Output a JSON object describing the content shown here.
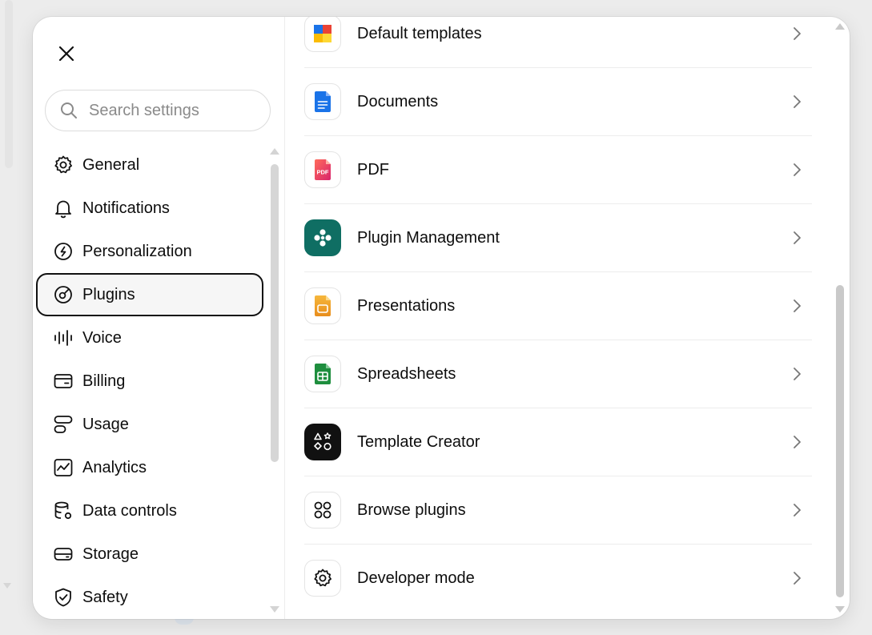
{
  "search": {
    "placeholder": "Search settings"
  },
  "sidebar": {
    "items": [
      {
        "label": "General",
        "icon": "gear-icon"
      },
      {
        "label": "Notifications",
        "icon": "bell-icon"
      },
      {
        "label": "Personalization",
        "icon": "personalization-icon"
      },
      {
        "label": "Plugins",
        "icon": "plugin-icon",
        "active": true
      },
      {
        "label": "Voice",
        "icon": "voice-waveform-icon"
      },
      {
        "label": "Billing",
        "icon": "card-icon"
      },
      {
        "label": "Usage",
        "icon": "usage-icon"
      },
      {
        "label": "Analytics",
        "icon": "analytics-chart-icon"
      },
      {
        "label": "Data controls",
        "icon": "database-gear-icon"
      },
      {
        "label": "Storage",
        "icon": "storage-drive-icon"
      },
      {
        "label": "Safety",
        "icon": "shield-check-icon"
      }
    ]
  },
  "plugins": {
    "items": [
      {
        "label": "Default templates",
        "icon": "default-templates-icon"
      },
      {
        "label": "Documents",
        "icon": "documents-icon"
      },
      {
        "label": "PDF",
        "icon": "pdf-icon",
        "icon_text": "PDF"
      },
      {
        "label": "Plugin Management",
        "icon": "plugin-management-icon"
      },
      {
        "label": "Presentations",
        "icon": "presentations-icon"
      },
      {
        "label": "Spreadsheets",
        "icon": "spreadsheets-icon"
      },
      {
        "label": "Template Creator",
        "icon": "template-creator-icon"
      },
      {
        "label": "Browse plugins",
        "icon": "browse-grid-icon"
      },
      {
        "label": "Developer mode",
        "icon": "developer-gear-icon"
      }
    ]
  },
  "colors": {
    "active_border": "#111111",
    "plugin_management_bg": "#0f6e63",
    "template_creator_bg": "#111111",
    "documents_blue": "#1a73e8",
    "pdf_red": "#e53948",
    "presentations_orange": "#f0a830",
    "spreadsheets_green": "#1e8e3e"
  }
}
